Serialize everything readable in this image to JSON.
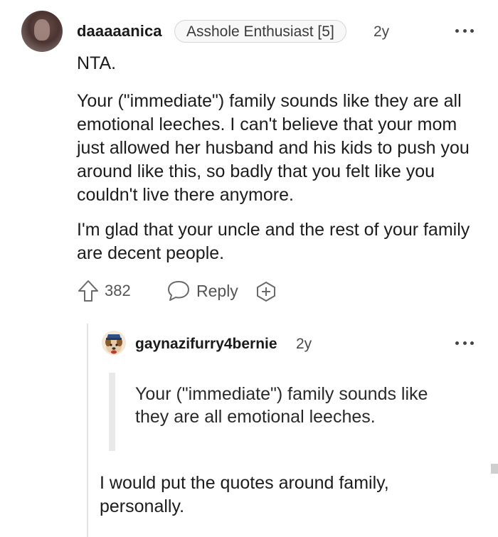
{
  "comment": {
    "username": "daaaaanica",
    "flair": "Asshole Enthusiast [5]",
    "age": "2y",
    "paragraphs": [
      "NTA.",
      "Your (\"immediate\") family sounds like they are all emotional leeches. I can't believe that your mom just allowed her husband and his kids to push you around like this, so badly that you felt like you couldn't live there anymore.",
      "I'm glad that your uncle and the rest of your family are decent people."
    ],
    "upvotes": "382",
    "reply_label": "Reply"
  },
  "reply": {
    "username": "gaynazifurry4bernie",
    "age": "2y",
    "quote": "Your (\"immediate\") family sounds like they are all emotional leeches.",
    "text": "I would put the quotes around family, personally."
  },
  "icons": {
    "upvote": "upvote-arrow-icon",
    "reply": "speech-bubble-icon",
    "award": "plus-award-icon",
    "more": "more-dots-icon"
  }
}
